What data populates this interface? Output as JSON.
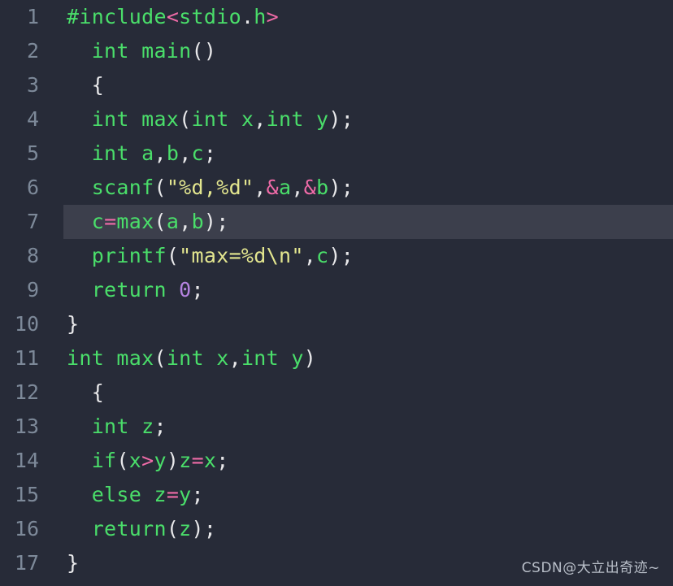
{
  "editor": {
    "background_color": "#272b38",
    "active_line_color": "#3c3f4c",
    "gutter_color": "#7d8999",
    "language": "c",
    "active_line": 7,
    "total_lines": 17,
    "colors": {
      "keyword": "#4ade6a",
      "identifier": "#4ade6a",
      "punctuation": "#e8e8ea",
      "string": "#e3e68f",
      "operator": "#f06ba8",
      "number": "#b583e0"
    },
    "lines": [
      {
        "number": "1",
        "active": false,
        "tokens": [
          {
            "text": "#include",
            "type": "kw"
          },
          {
            "text": "<",
            "type": "op"
          },
          {
            "text": "stdio",
            "type": "kw"
          },
          {
            "text": ".",
            "type": "dot"
          },
          {
            "text": "h",
            "type": "kw"
          },
          {
            "text": ">",
            "type": "op"
          }
        ]
      },
      {
        "number": "2",
        "active": false,
        "tokens": [
          {
            "text": "  ",
            "type": "punc"
          },
          {
            "text": "int main",
            "type": "kw"
          },
          {
            "text": "()",
            "type": "punc"
          }
        ]
      },
      {
        "number": "3",
        "active": false,
        "tokens": [
          {
            "text": "  ",
            "type": "punc"
          },
          {
            "text": "{",
            "type": "punc"
          }
        ]
      },
      {
        "number": "4",
        "active": false,
        "tokens": [
          {
            "text": "  ",
            "type": "punc"
          },
          {
            "text": "int max",
            "type": "kw"
          },
          {
            "text": "(",
            "type": "punc"
          },
          {
            "text": "int x",
            "type": "kw"
          },
          {
            "text": ",",
            "type": "punc"
          },
          {
            "text": "int y",
            "type": "kw"
          },
          {
            "text": ");",
            "type": "punc"
          }
        ]
      },
      {
        "number": "5",
        "active": false,
        "tokens": [
          {
            "text": "  ",
            "type": "punc"
          },
          {
            "text": "int a",
            "type": "kw"
          },
          {
            "text": ",",
            "type": "punc"
          },
          {
            "text": "b",
            "type": "kw"
          },
          {
            "text": ",",
            "type": "punc"
          },
          {
            "text": "c",
            "type": "kw"
          },
          {
            "text": ";",
            "type": "punc"
          }
        ]
      },
      {
        "number": "6",
        "active": false,
        "tokens": [
          {
            "text": "  ",
            "type": "punc"
          },
          {
            "text": "scanf",
            "type": "fn"
          },
          {
            "text": "(",
            "type": "punc"
          },
          {
            "text": "\"%d,%d\"",
            "type": "str"
          },
          {
            "text": ",",
            "type": "punc"
          },
          {
            "text": "&",
            "type": "op"
          },
          {
            "text": "a",
            "type": "kw"
          },
          {
            "text": ",",
            "type": "punc"
          },
          {
            "text": "&",
            "type": "op"
          },
          {
            "text": "b",
            "type": "kw"
          },
          {
            "text": ");",
            "type": "punc"
          }
        ]
      },
      {
        "number": "7",
        "active": true,
        "tokens": [
          {
            "text": "  ",
            "type": "punc"
          },
          {
            "text": "c",
            "type": "kw"
          },
          {
            "text": "=",
            "type": "op"
          },
          {
            "text": "max",
            "type": "fn"
          },
          {
            "text": "(",
            "type": "punc"
          },
          {
            "text": "a",
            "type": "kw"
          },
          {
            "text": ",",
            "type": "punc"
          },
          {
            "text": "b",
            "type": "kw"
          },
          {
            "text": ");",
            "type": "punc"
          }
        ]
      },
      {
        "number": "8",
        "active": false,
        "tokens": [
          {
            "text": "  ",
            "type": "punc"
          },
          {
            "text": "printf",
            "type": "fn"
          },
          {
            "text": "(",
            "type": "punc"
          },
          {
            "text": "\"max=%d\\n\"",
            "type": "str"
          },
          {
            "text": ",",
            "type": "punc"
          },
          {
            "text": "c",
            "type": "kw"
          },
          {
            "text": ");",
            "type": "punc"
          }
        ]
      },
      {
        "number": "9",
        "active": false,
        "tokens": [
          {
            "text": "  ",
            "type": "punc"
          },
          {
            "text": "return ",
            "type": "kw"
          },
          {
            "text": "0",
            "type": "num"
          },
          {
            "text": ";",
            "type": "punc"
          }
        ]
      },
      {
        "number": "10",
        "active": false,
        "tokens": [
          {
            "text": "}",
            "type": "punc"
          }
        ]
      },
      {
        "number": "11",
        "active": false,
        "tokens": [
          {
            "text": "int max",
            "type": "kw"
          },
          {
            "text": "(",
            "type": "punc"
          },
          {
            "text": "int x",
            "type": "kw"
          },
          {
            "text": ",",
            "type": "punc"
          },
          {
            "text": "int y",
            "type": "kw"
          },
          {
            "text": ")",
            "type": "punc"
          }
        ]
      },
      {
        "number": "12",
        "active": false,
        "tokens": [
          {
            "text": "  ",
            "type": "punc"
          },
          {
            "text": "{",
            "type": "punc"
          }
        ]
      },
      {
        "number": "13",
        "active": false,
        "tokens": [
          {
            "text": "  ",
            "type": "punc"
          },
          {
            "text": "int z",
            "type": "kw"
          },
          {
            "text": ";",
            "type": "punc"
          }
        ]
      },
      {
        "number": "14",
        "active": false,
        "tokens": [
          {
            "text": "  ",
            "type": "punc"
          },
          {
            "text": "if",
            "type": "kw"
          },
          {
            "text": "(",
            "type": "punc"
          },
          {
            "text": "x",
            "type": "kw"
          },
          {
            "text": ">",
            "type": "op"
          },
          {
            "text": "y",
            "type": "kw"
          },
          {
            "text": ")",
            "type": "punc"
          },
          {
            "text": "z",
            "type": "kw"
          },
          {
            "text": "=",
            "type": "op"
          },
          {
            "text": "x",
            "type": "kw"
          },
          {
            "text": ";",
            "type": "punc"
          }
        ]
      },
      {
        "number": "15",
        "active": false,
        "tokens": [
          {
            "text": "  ",
            "type": "punc"
          },
          {
            "text": "else z",
            "type": "kw"
          },
          {
            "text": "=",
            "type": "op"
          },
          {
            "text": "y",
            "type": "kw"
          },
          {
            "text": ";",
            "type": "punc"
          }
        ]
      },
      {
        "number": "16",
        "active": false,
        "tokens": [
          {
            "text": "  ",
            "type": "punc"
          },
          {
            "text": "return",
            "type": "kw"
          },
          {
            "text": "(",
            "type": "punc"
          },
          {
            "text": "z",
            "type": "kw"
          },
          {
            "text": ");",
            "type": "punc"
          }
        ]
      },
      {
        "number": "17",
        "active": false,
        "tokens": [
          {
            "text": "}",
            "type": "punc"
          }
        ]
      }
    ]
  },
  "watermark": {
    "text": "CSDN@大立出奇迹~",
    "color": "#b9bfc9"
  }
}
